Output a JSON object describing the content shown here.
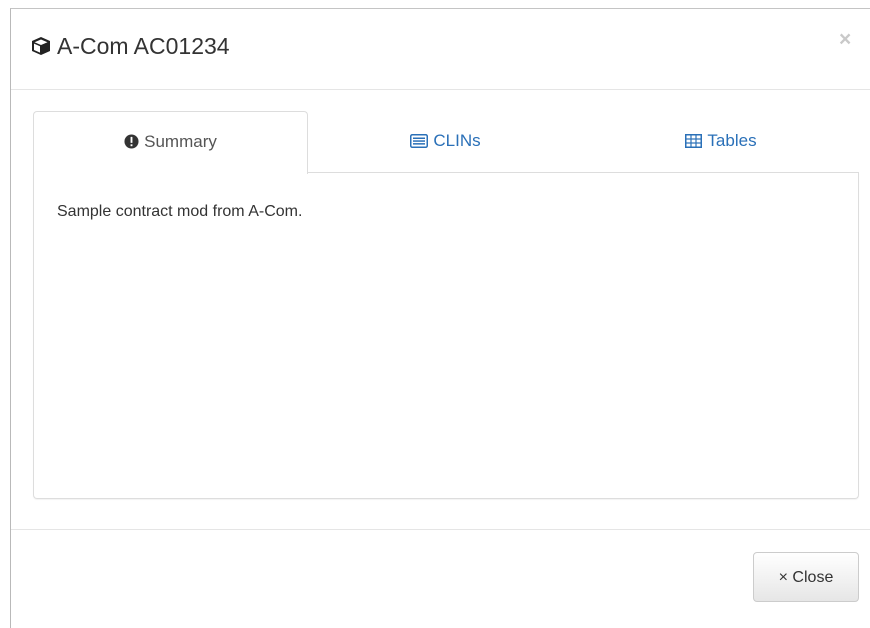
{
  "modal": {
    "title": "A-Com AC01234",
    "title_icon": "cube-icon",
    "close_icon": "×"
  },
  "tabs": [
    {
      "label": "Summary",
      "icon": "exclamation-circle-icon",
      "active": true
    },
    {
      "label": "CLINs",
      "icon": "list-alt-icon",
      "active": false
    },
    {
      "label": "Tables",
      "icon": "table-icon",
      "active": false
    }
  ],
  "panel": {
    "text": "Sample contract mod from A-Com."
  },
  "footer": {
    "close_label": "× Close"
  },
  "colors": {
    "link": "#2a70b8",
    "text": "#333333",
    "border": "#dddddd"
  }
}
